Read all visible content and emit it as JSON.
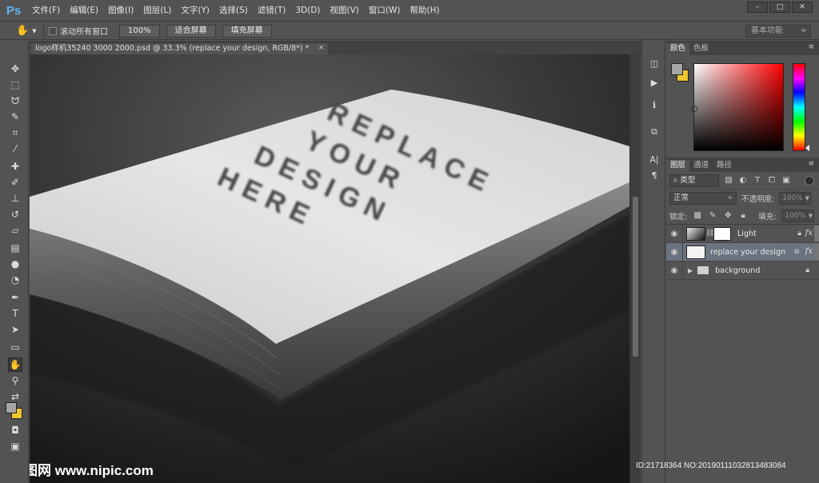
{
  "app": {
    "logo": "Ps",
    "menu": [
      "文件(F)",
      "编辑(E)",
      "图像(I)",
      "图层(L)",
      "文字(Y)",
      "选择(S)",
      "滤镜(T)",
      "3D(D)",
      "视图(V)",
      "窗口(W)",
      "帮助(H)"
    ],
    "window_controls": [
      "–",
      "□",
      "✕"
    ]
  },
  "options": {
    "tool_icon": "hand-icon",
    "scroll_all_label": "滚动所有窗口",
    "buttons": [
      "100%",
      "适合屏幕",
      "填充屏幕"
    ],
    "workspace": "基本功能"
  },
  "document": {
    "tab_title": "logo样机35240 3000 2000.psd @ 33.3% (replace your design, RGB/8*) *",
    "tab_close": "×"
  },
  "canvas": {
    "card_text": [
      "REPLACE",
      "YOUR",
      "DESIGN",
      "HERE"
    ],
    "watermark_left": "昵图网 www.nipic.com",
    "watermark_right": "ID:21718364 NO:20190111032813483084"
  },
  "color_panel": {
    "tabs": [
      "颜色",
      "色板"
    ],
    "menu_icon": "≡",
    "foreground": "#a6a6a6",
    "background": "#f0c62e"
  },
  "layers_panel": {
    "tabs": [
      "图层",
      "通道",
      "路径"
    ],
    "menu_icon": "≡",
    "filter_label": "⌕ 类型",
    "blend_mode": "正常",
    "opacity_label": "不透明度:",
    "opacity_value": "100%",
    "lock_label": "锁定:",
    "fill_label": "填充:",
    "fill_value": "100%",
    "layers": [
      {
        "name": "Light",
        "selected": false
      },
      {
        "name": "replace your design",
        "selected": true
      },
      {
        "name": "background",
        "selected": false
      }
    ]
  }
}
